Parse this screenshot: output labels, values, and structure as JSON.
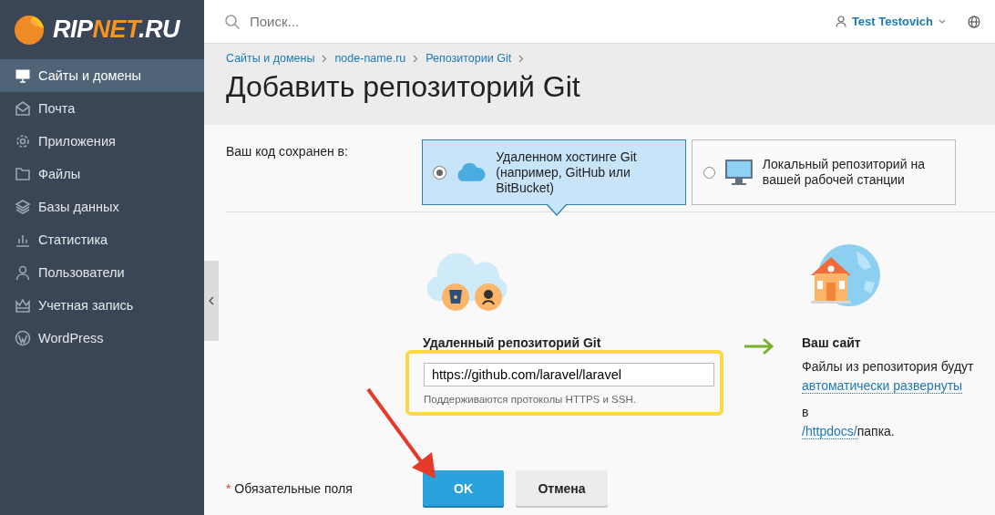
{
  "logo": {
    "parts": [
      {
        "text": "RIP",
        "accent": false
      },
      {
        "text": "NET",
        "accent": true
      },
      {
        "text": ".RU",
        "accent": false
      }
    ]
  },
  "sidebar": {
    "items": [
      {
        "label": "Сайты и домены",
        "selected": true
      },
      {
        "label": "Почта",
        "selected": false
      },
      {
        "label": "Приложения",
        "selected": false
      },
      {
        "label": "Файлы",
        "selected": false
      },
      {
        "label": "Базы данных",
        "selected": false
      },
      {
        "label": "Статистика",
        "selected": false
      },
      {
        "label": "Пользователи",
        "selected": false
      },
      {
        "label": "Учетная запись",
        "selected": false
      },
      {
        "label": "WordPress",
        "selected": false
      }
    ]
  },
  "header": {
    "search": {
      "placeholder": "Поиск..."
    },
    "user": "Test Testovich"
  },
  "breadcrumbs": [
    "Сайты и домены",
    "node-name.ru",
    "Репозитории Git"
  ],
  "title": "Добавить репозиторий Git",
  "source": {
    "label": "Ваш код сохранен в:",
    "options": [
      {
        "kind": "remote",
        "label": "Удаленном хостинге Git (например, GitHub или BitBucket)",
        "selected": true
      },
      {
        "kind": "local",
        "label": "Локальный репозиторий на вашей рабочей станции",
        "selected": false
      }
    ]
  },
  "remote": {
    "label": "Удаленный репозиторий Git",
    "value": "https://github.com/laravel/laravel",
    "hint": "Поддерживаются протоколы HTTPS и SSH.",
    "highlighted": true
  },
  "site": {
    "title": "Ваш сайт",
    "text": "Файлы из репозитория будут",
    "link": "автоматически развернуты",
    "text2": "в",
    "path_link": "/httpdocs/",
    "text3": "папка."
  },
  "required": {
    "mark": "*",
    "note": "Обязательные поля"
  },
  "buttons": [
    {
      "kind": "primary",
      "label": "OK"
    },
    {
      "kind": "secondary",
      "label": "Отмена"
    }
  ]
}
